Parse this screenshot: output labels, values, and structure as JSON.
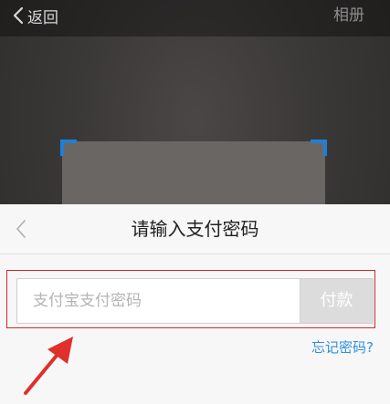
{
  "topbar": {
    "back_label": "返回",
    "album_label": "相册"
  },
  "sheet": {
    "title": "请输入支付密码",
    "password_placeholder": "支付宝支付密码",
    "pay_label": "付款",
    "forgot_label": "忘记密码?"
  },
  "colors": {
    "scan_corner": "#1f7fd6",
    "highlight_border": "#d3262a",
    "link": "#2e8fe0",
    "annotation_arrow": "#e0302c"
  },
  "icons": {
    "back": "chevron-left-icon",
    "sheet_back": "chevron-left-icon",
    "annotation": "arrow-icon"
  }
}
